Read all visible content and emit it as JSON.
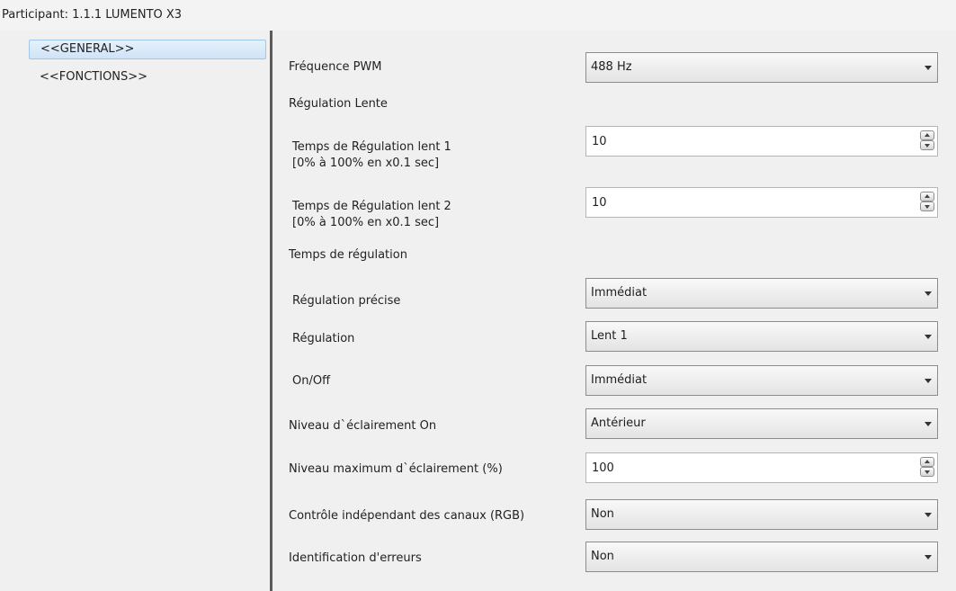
{
  "title": "Participant: 1.1.1  LUMENTO X3",
  "sidebar": {
    "items": [
      {
        "label": "<<GENERAL>>",
        "selected": true
      },
      {
        "label": "<<FONCTIONS>>",
        "selected": false
      }
    ]
  },
  "params": {
    "pwm": {
      "label": "Fréquence PWM",
      "value": "488 Hz"
    },
    "slow_section": {
      "label": "Régulation Lente"
    },
    "slow1": {
      "label": "Temps de Régulation lent 1",
      "sublabel": "[0% à 100% en x0.1 sec]",
      "value": "10"
    },
    "slow2": {
      "label": "Temps de Régulation lent 2",
      "sublabel": "[0% à 100% en x0.1 sec]",
      "value": "10"
    },
    "reg_section": {
      "label": "Temps de régulation"
    },
    "precise": {
      "label": "Régulation précise",
      "value": "Immédiat"
    },
    "regulation": {
      "label": "Régulation",
      "value": "Lent 1"
    },
    "onoff": {
      "label": "On/Off",
      "value": "Immédiat"
    },
    "level_on": {
      "label": "Niveau d`éclairement On",
      "value": "Antérieur"
    },
    "level_max": {
      "label": "Niveau maximum d`éclairement (%)",
      "value": "100"
    },
    "rgb": {
      "label": "Contrôle indépendant des canaux (RGB)",
      "value": "Non"
    },
    "errors": {
      "label": "Identification d'erreurs",
      "value": "Non"
    }
  }
}
